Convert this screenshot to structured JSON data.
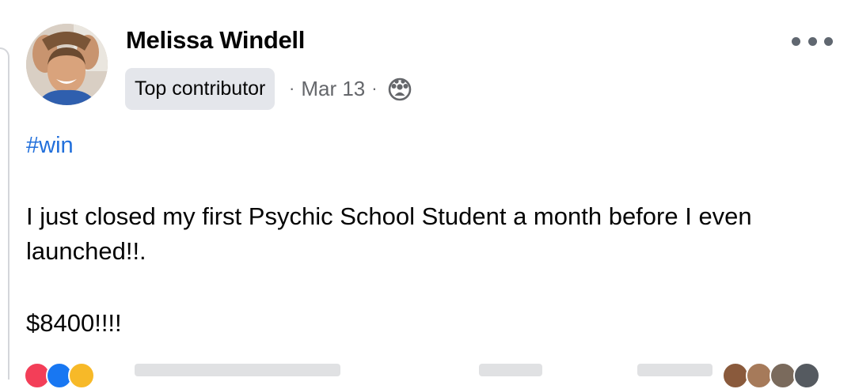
{
  "post": {
    "author_name": "Melissa Windell",
    "badge": "Top contributor",
    "separator": "·",
    "date": "Mar 13",
    "audience_icon": "group-icon",
    "more_icon": "more-horizontal-icon",
    "hashtag": "#win",
    "body_text": "I just closed my first Psychic School Student a month before I even launched!!.",
    "amount_text": "$8400!!!!"
  },
  "colors": {
    "hashtag": "#216fdb",
    "meta_text": "#65676b",
    "badge_bg": "#e4e6eb",
    "reaction_love": "#f33e58",
    "reaction_like": "#1877f2",
    "reaction_haha": "#f7b928"
  }
}
